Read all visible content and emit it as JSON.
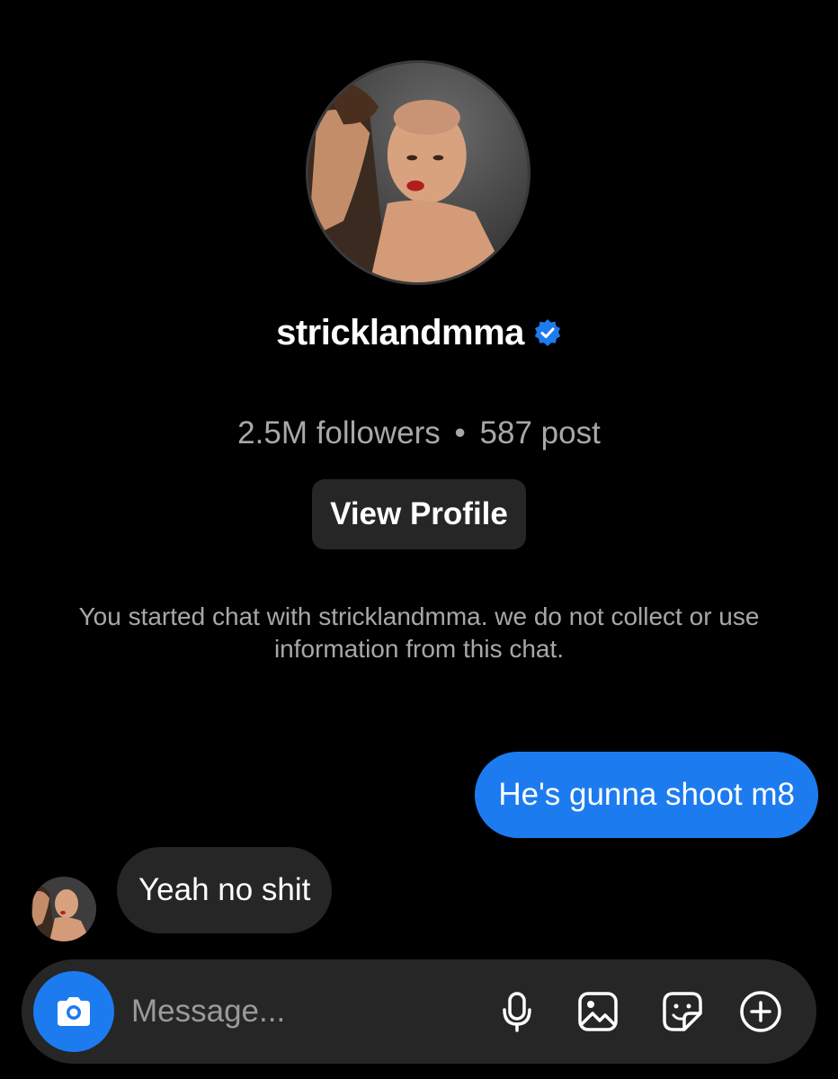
{
  "profile": {
    "username": "stricklandmma",
    "verified": true,
    "stats": {
      "followers": "2.5M followers",
      "separator": "•",
      "posts": "587 post"
    },
    "view_profile_label": "View Profile"
  },
  "notice": "You started chat with stricklandmma. we do not collect or use information from this chat.",
  "messages": [
    {
      "direction": "outgoing",
      "text": "He's gunna shoot m8"
    },
    {
      "direction": "incoming",
      "text": "Yeah no shit"
    }
  ],
  "composer": {
    "placeholder": "Message...",
    "icons": [
      "camera-icon",
      "microphone-icon",
      "gallery-icon",
      "sticker-icon",
      "plus-icon"
    ]
  },
  "colors": {
    "background": "#000000",
    "accent": "#1d7bf0",
    "bubble_incoming": "#262626",
    "secondary_text": "#a8a8a8"
  }
}
